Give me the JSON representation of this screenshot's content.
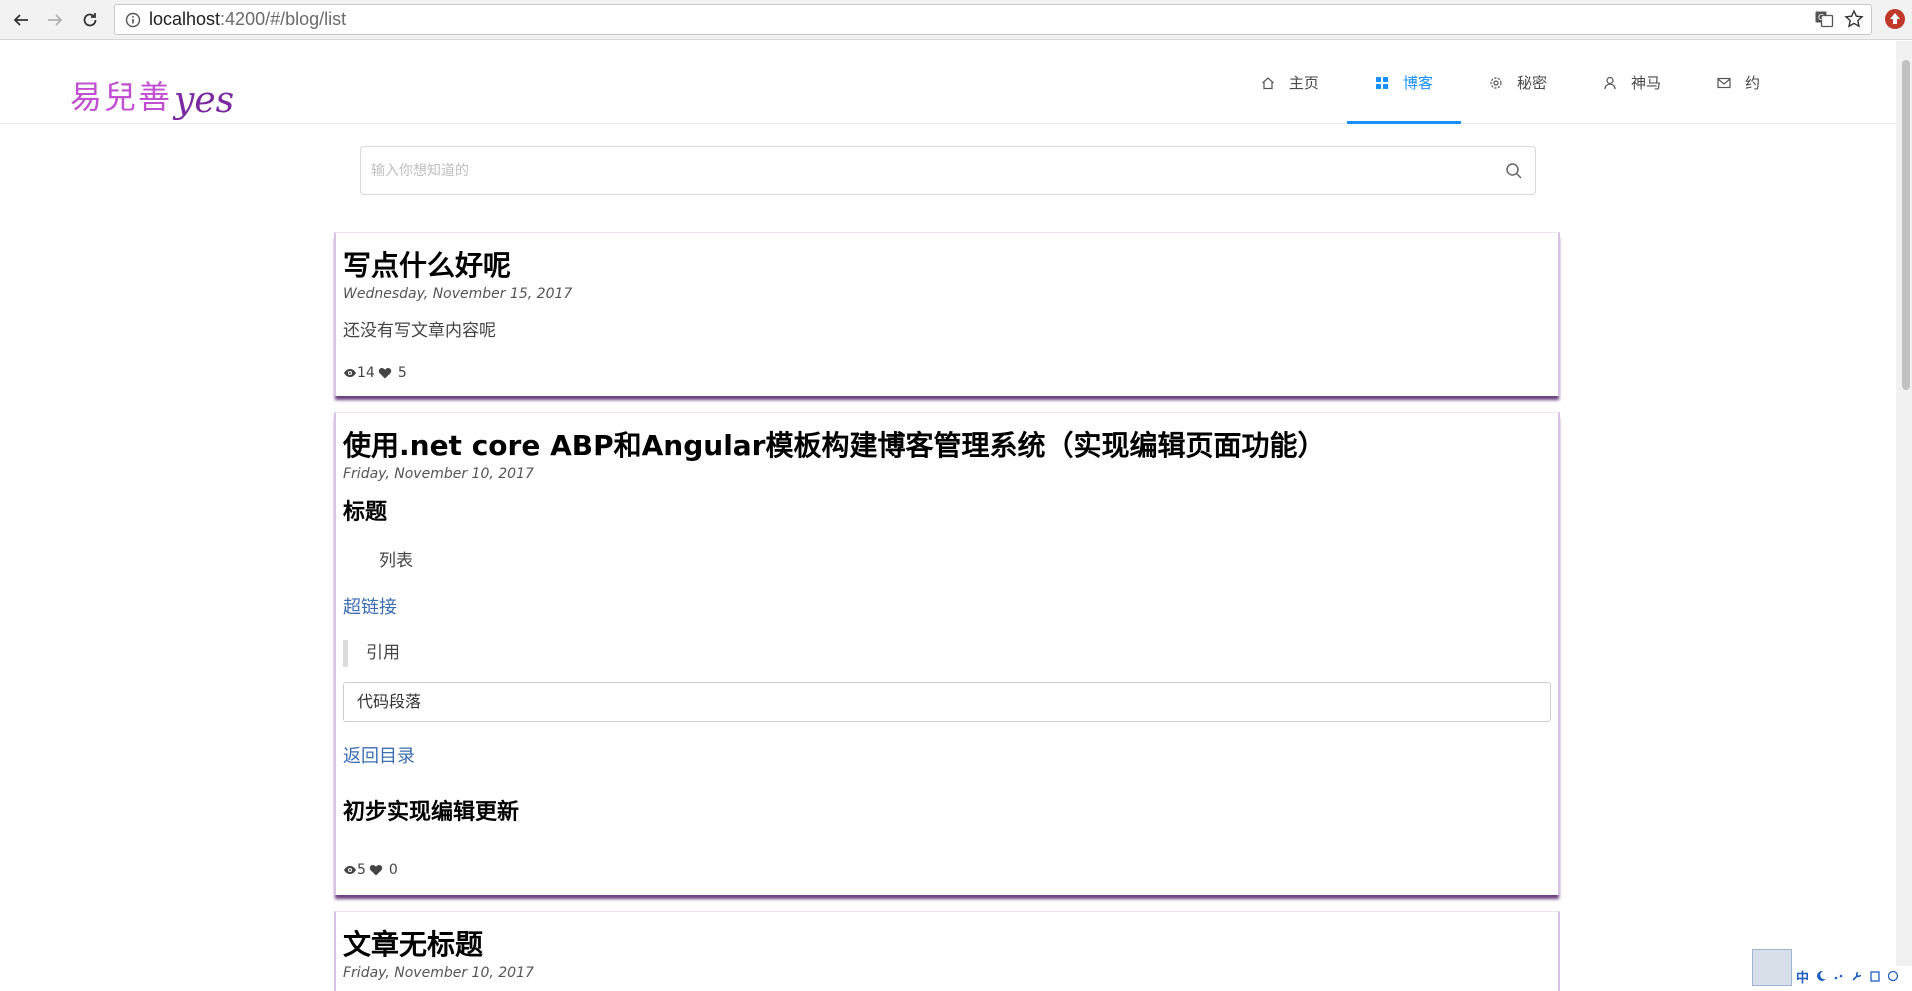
{
  "browser": {
    "url_host": "localhost",
    "url_rest": ":4200/#/blog/list"
  },
  "site": {
    "logo_cn": "易兒善",
    "logo_en": "yes"
  },
  "nav": [
    {
      "label": "主页",
      "icon": "home-icon",
      "active": false
    },
    {
      "label": "博客",
      "icon": "grid-icon",
      "active": true
    },
    {
      "label": "秘密",
      "icon": "gear-icon",
      "active": false
    },
    {
      "label": "神马",
      "icon": "user-icon",
      "active": false
    },
    {
      "label": "约",
      "icon": "mail-icon",
      "active": false
    }
  ],
  "search": {
    "placeholder": "输入你想知道的"
  },
  "posts": [
    {
      "title": "写点什么好呢",
      "date": "Wednesday, November 15, 2017",
      "summary": "还没有写文章内容呢",
      "views": "14",
      "likes": "5"
    },
    {
      "title": "使用.net core ABP和Angular模板构建博客管理系统（实现编辑页面功能）",
      "date": "Friday, November 10, 2017",
      "heading": "标题",
      "list_item": "列表",
      "link": "超链接",
      "quote": "引用",
      "code": "代码段落",
      "back_link": "返回目录",
      "subheading": "初步实现编辑更新",
      "views": "5",
      "likes": "0"
    },
    {
      "title": "文章无标题",
      "date": "Friday, November 10, 2017"
    }
  ],
  "ime": {
    "label": "中"
  },
  "colors": {
    "accent": "#1890ff",
    "card_shadow": "#6b3f7f",
    "logo": "#c24fd1"
  }
}
